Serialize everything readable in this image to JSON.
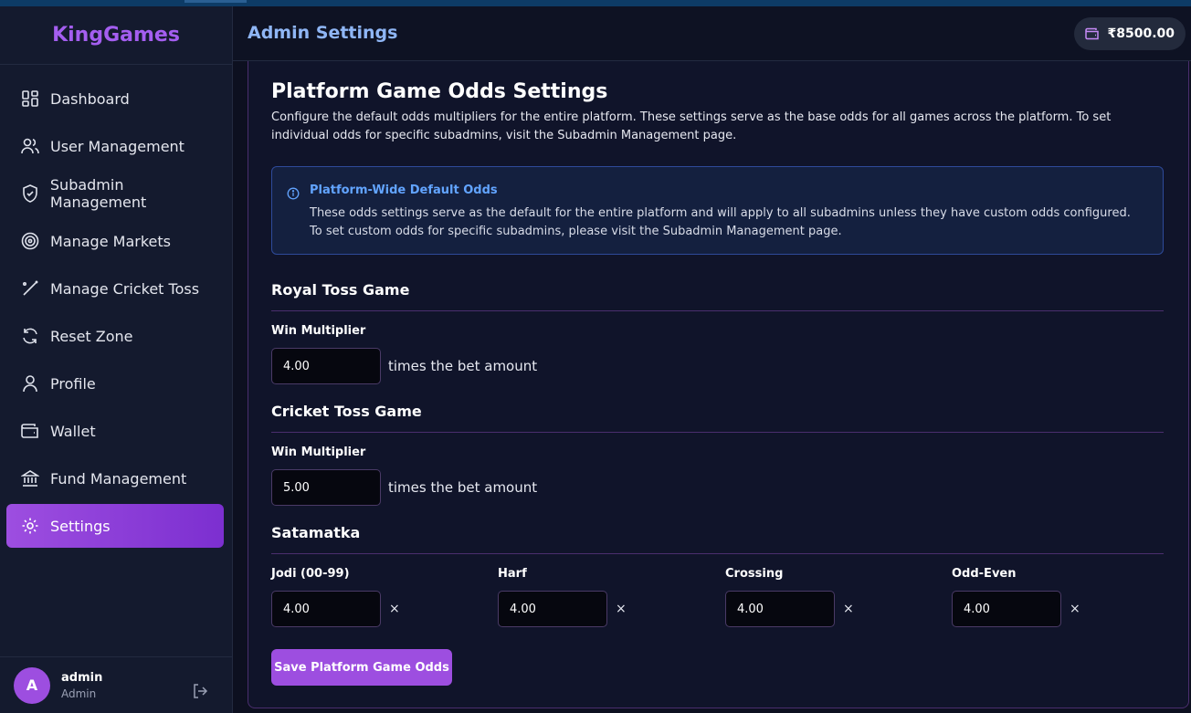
{
  "brand": "KingGames",
  "header": {
    "title": "Admin Settings",
    "balance": "₹8500.00"
  },
  "sidebar": {
    "items": [
      {
        "label": "Dashboard",
        "icon": "dashboard-icon"
      },
      {
        "label": "User Management",
        "icon": "users-icon"
      },
      {
        "label": "Subadmin Management",
        "icon": "shield-icon"
      },
      {
        "label": "Manage Markets",
        "icon": "target-icon"
      },
      {
        "label": "Manage Cricket Toss",
        "icon": "bat-icon"
      },
      {
        "label": "Reset Zone",
        "icon": "refresh-icon"
      },
      {
        "label": "Profile",
        "icon": "user-icon"
      },
      {
        "label": "Wallet",
        "icon": "wallet-icon"
      },
      {
        "label": "Fund Management",
        "icon": "bank-icon"
      },
      {
        "label": "Settings",
        "icon": "gear-icon",
        "active": true
      }
    ],
    "user": {
      "initial": "A",
      "name": "admin",
      "role": "Admin"
    }
  },
  "main": {
    "title": "Platform Game Odds Settings",
    "description": "Configure the default odds multipliers for the entire platform. These settings serve as the base odds for all games across the platform. To set individual odds for specific subadmins, visit the Subadmin Management page.",
    "info": {
      "title": "Platform-Wide Default Odds",
      "body": "These odds settings serve as the default for the entire platform and will apply to all subadmins unless they have custom odds configured. To set custom odds for specific subadmins, please visit the Subadmin Management page."
    },
    "royal_toss": {
      "heading": "Royal Toss Game",
      "label": "Win Multiplier",
      "value": "4.00",
      "suffix": "times the bet amount"
    },
    "cricket_toss": {
      "heading": "Cricket Toss Game",
      "label": "Win Multiplier",
      "value": "5.00",
      "suffix": "times the bet amount"
    },
    "satamatka": {
      "heading": "Satamatka",
      "fields": [
        {
          "label": "Jodi (00-99)",
          "value": "4.00"
        },
        {
          "label": "Harf",
          "value": "4.00"
        },
        {
          "label": "Crossing",
          "value": "4.00"
        },
        {
          "label": "Odd-Even",
          "value": "4.00"
        }
      ],
      "times_symbol": "×"
    },
    "save_label": "Save Platform Game Odds"
  },
  "colors": {
    "accent": "#9d4ee0",
    "brand": "#a45ef0",
    "info": "#62a4ff"
  }
}
